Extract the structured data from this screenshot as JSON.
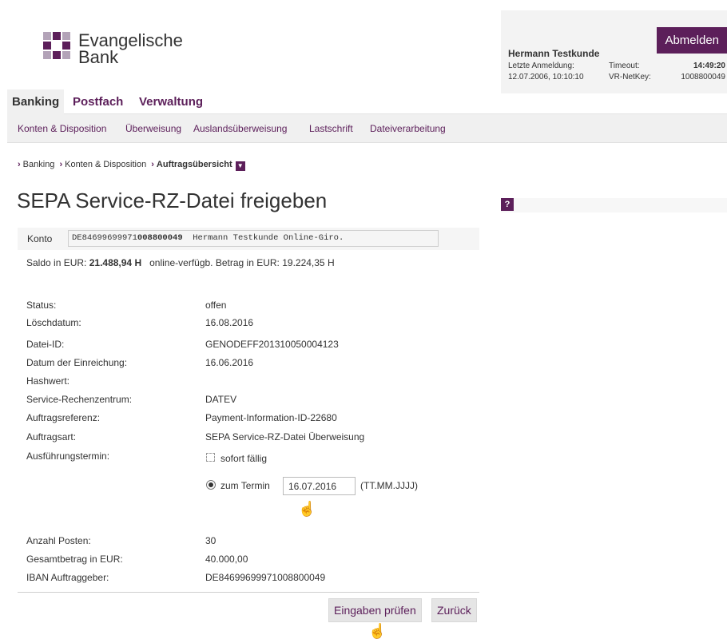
{
  "brand": {
    "line1": "Evangelische",
    "line2": "Bank",
    "colors": {
      "primary": "#5c1f5a",
      "light": "#b3a3b8"
    }
  },
  "session": {
    "logout_label": "Abmelden",
    "user_name": "Hermann Testkunde",
    "last_login_label": "Letzte Anmeldung:",
    "last_login_value": "12.07.2006, 10:10:10",
    "timeout_label": "Timeout:",
    "timeout_value": "14:49:20",
    "netkey_label": "VR-NetKey:",
    "netkey_value": "1008800049"
  },
  "main_nav": {
    "tabs": [
      {
        "label": "Banking",
        "active": true
      },
      {
        "label": "Postfach",
        "active": false
      },
      {
        "label": "Verwaltung",
        "active": false
      }
    ]
  },
  "sub_nav": {
    "items": [
      {
        "label": "Konten & Disposition"
      },
      {
        "label": "Überweisung"
      },
      {
        "label": "Auslandsüberweisung"
      },
      {
        "label": "Lastschrift"
      },
      {
        "label": "Dateiverarbeitung"
      }
    ]
  },
  "breadcrumb": {
    "items": [
      "Banking",
      "Konten & Disposition"
    ],
    "current": "Auftragsübersicht"
  },
  "page": {
    "title": "SEPA Service-RZ-Datei freigeben",
    "help_label": "?"
  },
  "account": {
    "label": "Konto",
    "iban_prefix": "DE84699699971",
    "iban_suffix": "008800049",
    "account_rest": "Hermann Testkunde Online-Giro.",
    "saldo_label": "Saldo in EUR:",
    "saldo_value": "21.488,94 H",
    "available_label": "online-verfügb. Betrag in EUR:",
    "available_value": "19.224,35 H"
  },
  "details": {
    "status_label": "Status:",
    "status_value": "offen",
    "delete_date_label": "Löschdatum:",
    "delete_date_value": "16.08.2016",
    "file_id_label": "Datei-ID:",
    "file_id_value": "GENODEFF201310050004123",
    "submit_date_label": "Datum der Einreichung:",
    "submit_date_value": "16.06.2016",
    "hash_label": "Hashwert:",
    "rz_label": "Service-Rechenzentrum:",
    "rz_value": "DATEV",
    "reference_label": "Auftragsreferenz:",
    "reference_value": "Payment-Information-ID-22680",
    "type_label": "Auftragsart:",
    "type_value": "SEPA Service-RZ-Datei Überweisung",
    "execution_label": "Ausführungstermin:",
    "option_immediate": "sofort fällig",
    "option_date": "zum Termin",
    "date_value": "16.07.2016",
    "date_format": "(TT.MM.JJJJ)",
    "count_label": "Anzahl Posten:",
    "count_value": "30",
    "total_label": "Gesamtbetrag in EUR:",
    "total_value": "40.000,00",
    "iban_label": "IBAN Auftraggeber:",
    "iban_value": "DE84699699971008800049"
  },
  "actions": {
    "check_label": "Eingaben prüfen",
    "back_label": "Zurück"
  }
}
